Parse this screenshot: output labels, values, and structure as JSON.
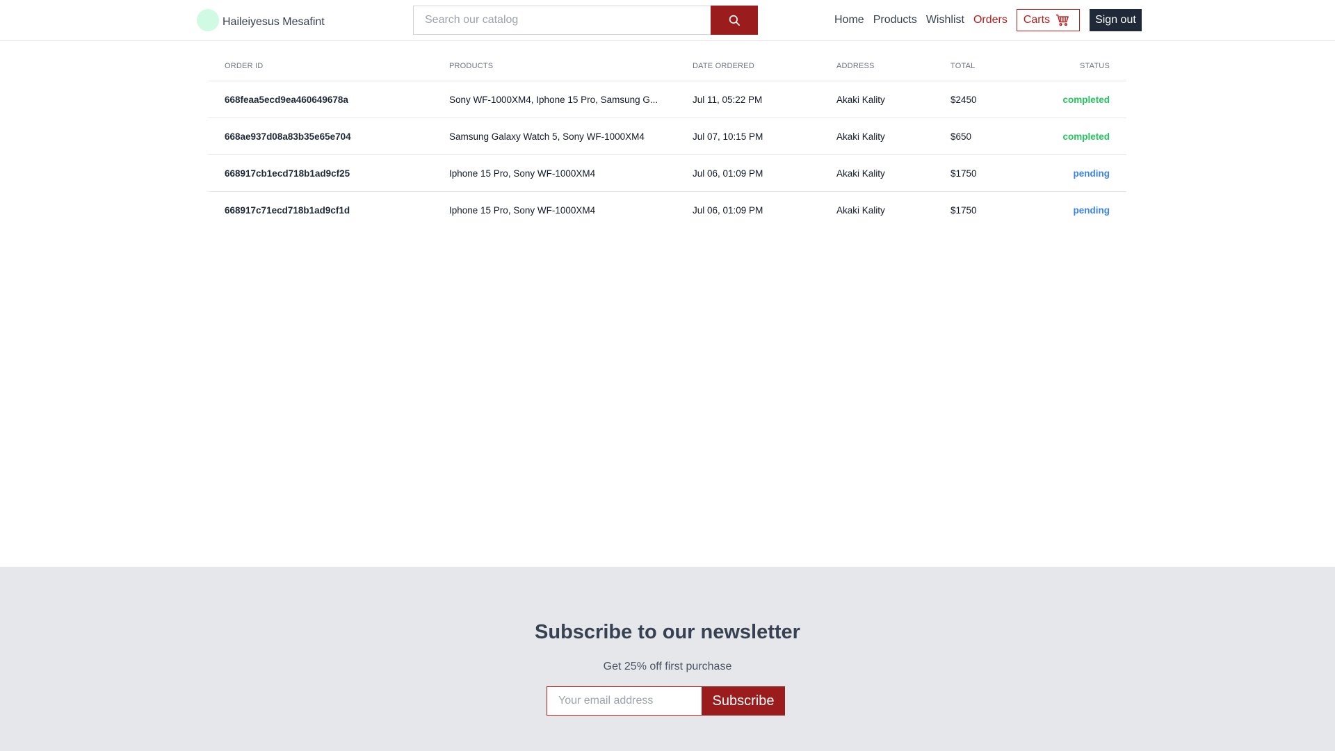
{
  "header": {
    "user_name": "Haileiyesus Mesafint",
    "search_placeholder": "Search our catalog",
    "nav": [
      {
        "label": "Home"
      },
      {
        "label": "Products"
      },
      {
        "label": "Wishlist"
      },
      {
        "label": "Orders",
        "active": true
      }
    ],
    "carts_label": "Carts",
    "signout_label": "Sign out",
    "colors": {
      "accent": "#9b1c1c",
      "active_nav": "#b91c1c"
    }
  },
  "orders": {
    "columns": [
      "ORDER ID",
      "PRODUCTS",
      "DATE ORDERED",
      "ADDRESS",
      "TOTAL",
      "STATUS"
    ],
    "rows": [
      {
        "id": "668feaa5ecd9ea460649678a",
        "products": "Sony WF-1000XM4, Iphone 15 Pro, Samsung G...",
        "date": "Jul 11, 05:22 PM",
        "address": "Akaki Kality",
        "total": "$2450",
        "status": "completed"
      },
      {
        "id": "668ae937d08a83b35e65e704",
        "products": "Samsung Galaxy Watch 5, Sony WF-1000XM4",
        "date": "Jul 07, 10:15 PM",
        "address": "Akaki Kality",
        "total": "$650",
        "status": "completed"
      },
      {
        "id": "668917cb1ecd718b1ad9cf25",
        "products": "Iphone 15 Pro, Sony WF-1000XM4",
        "date": "Jul 06, 01:09 PM",
        "address": "Akaki Kality",
        "total": "$1750",
        "status": "pending"
      },
      {
        "id": "668917c71ecd718b1ad9cf1d",
        "products": "Iphone 15 Pro, Sony WF-1000XM4",
        "date": "Jul 06, 01:09 PM",
        "address": "Akaki Kality",
        "total": "$1750",
        "status": "pending"
      }
    ],
    "status_colors": {
      "completed": "#22c55e",
      "pending": "#3b82f6"
    }
  },
  "newsletter": {
    "title": "Subscribe to our newsletter",
    "subtitle": "Get 25% off first purchase",
    "email_placeholder": "Your email address",
    "button_label": "Subscribe"
  }
}
